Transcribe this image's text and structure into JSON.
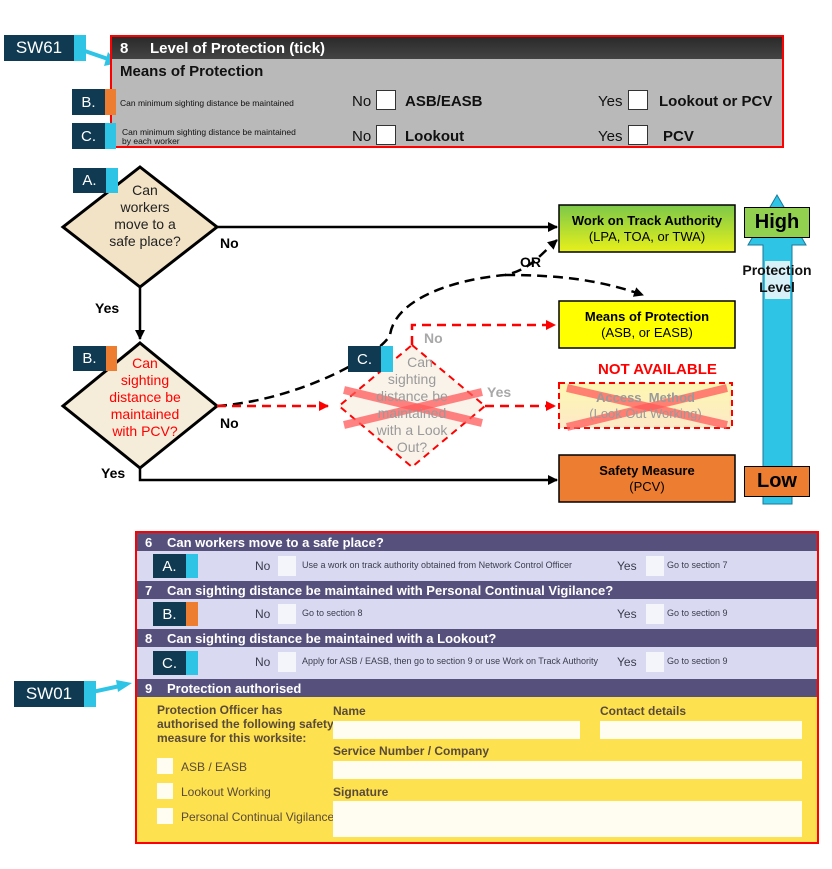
{
  "callouts": {
    "sw61": "SW61",
    "sw01": "SW01",
    "a": "A.",
    "b": "B.",
    "c": "C."
  },
  "colors": {
    "tag_dark": "#0f3a52",
    "cyan": "#2ec4e6",
    "orange": "#ed7d31",
    "red": "#ff0000",
    "green": "#92d050",
    "yellow": "#ffff00",
    "form_purple": "#56507d",
    "form_yellow": "#fde14f"
  },
  "sw61_form": {
    "section_number": "8",
    "section_title": "Level of Protection (tick)",
    "subtitle": "Means of Protection",
    "rows": [
      {
        "tag": "B.",
        "question": "Can minimum sighting distance be maintained",
        "no_label": "No",
        "no_option": "ASB/EASB",
        "yes_label": "Yes",
        "yes_option": "Lookout or PCV"
      },
      {
        "tag": "C.",
        "question_line1": "Can minimum sighting distance be maintained",
        "question_line2": "by each worker",
        "no_label": "No",
        "no_option": "Lookout",
        "yes_label": "Yes",
        "yes_option": "PCV"
      }
    ]
  },
  "flowchart": {
    "decision_a": {
      "tag": "A.",
      "lines": [
        "Can",
        "workers",
        "move to a",
        "safe place?"
      ]
    },
    "decision_b": {
      "tag": "B.",
      "lines": [
        "Can",
        "sighting",
        "distance be",
        "maintained",
        "with PCV?"
      ]
    },
    "decision_c": {
      "tag": "C.",
      "lines": [
        "Can",
        "sighting",
        "distance be",
        "maintained",
        "with a Look",
        "Out?"
      ],
      "status": "crossed-out"
    },
    "edges": {
      "a_no": "No",
      "a_yes": "Yes",
      "b_no": "No",
      "b_yes": "Yes",
      "c_no": "No",
      "c_yes": "Yes",
      "or": "OR"
    },
    "outcomes": {
      "wota": {
        "title": "Work on Track Authority",
        "subtitle": "(LPA, TOA, or TWA)"
      },
      "mop": {
        "title": "Means of Protection",
        "subtitle": "(ASB, or EASB)"
      },
      "access": {
        "title": "Access  Method",
        "subtitle": "(Look Out Working)",
        "status_label": "NOT AVAILABLE"
      },
      "safety": {
        "title": "Safety Measure",
        "subtitle": "(PCV)"
      }
    },
    "protection_scale": {
      "high": "High",
      "low": "Low",
      "label_line1": "Protection",
      "label_line2": "Level"
    }
  },
  "sw01_form": {
    "sections": [
      {
        "number": "6",
        "title": "Can workers move to a safe place?",
        "tag": "A.",
        "no_label": "No",
        "no_text": "Use a work on track authority obtained from Network Control Officer",
        "yes_label": "Yes",
        "yes_text": "Go to section 7"
      },
      {
        "number": "7",
        "title": "Can sighting distance be maintained with Personal Continual Vigilance?",
        "tag": "B.",
        "no_label": "No",
        "no_text": "Go to section 8",
        "yes_label": "Yes",
        "yes_text": "Go to section 9"
      },
      {
        "number": "8",
        "title": "Can sighting distance be maintained with a Lookout?",
        "tag": "C.",
        "no_label": "No",
        "no_text": "Apply for ASB / EASB, then go to section 9 or use Work on Track Authority",
        "yes_label": "Yes",
        "yes_text": "Go to section 9"
      }
    ],
    "section9": {
      "number": "9",
      "title": "Protection authorised",
      "intro": [
        "Protection Officer has",
        "authorised the following safety",
        "measure for this worksite:"
      ],
      "options": [
        "ASB / EASB",
        "Lookout Working",
        "Personal Continual Vigilance"
      ],
      "fields": {
        "name": {
          "label": "Name",
          "value": ""
        },
        "contact": {
          "label": "Contact details",
          "value": ""
        },
        "service": {
          "label": "Service Number / Company",
          "value": ""
        },
        "signature": {
          "label": "Signature",
          "value": ""
        }
      }
    }
  }
}
